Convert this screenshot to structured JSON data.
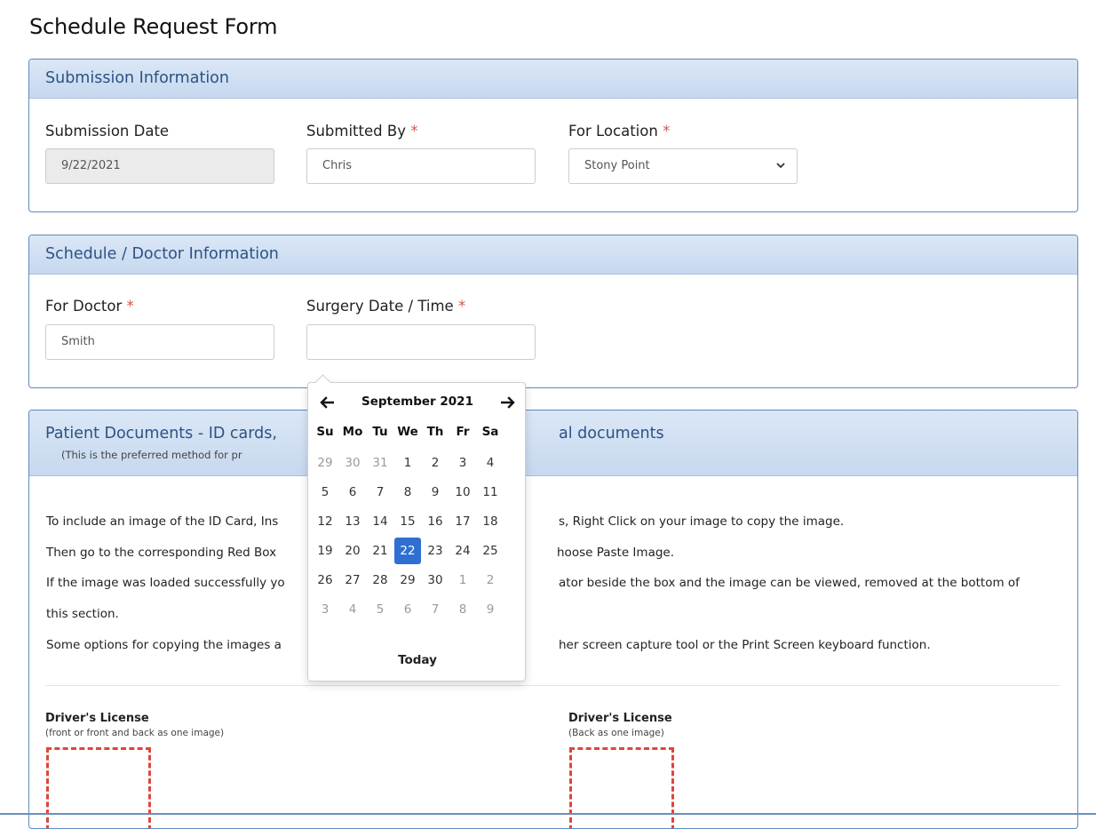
{
  "page": {
    "title": "Schedule Request Form"
  },
  "submission_panel": {
    "heading": "Submission Information",
    "submission_date": {
      "label": "Submission Date",
      "value": "9/22/2021"
    },
    "submitted_by": {
      "label": "Submitted By",
      "required_mark": "*",
      "value": "Chris"
    },
    "for_location": {
      "label": "For Location",
      "required_mark": "*",
      "value": "Stony Point"
    }
  },
  "schedule_panel": {
    "heading": "Schedule / Doctor Information",
    "for_doctor": {
      "label": "For Doctor",
      "required_mark": "*",
      "value": "Smith"
    },
    "surgery_date": {
      "label": "Surgery Date / Time",
      "required_mark": "*",
      "value": ""
    }
  },
  "documents_panel": {
    "heading_left": "Patient Documents - ID cards,",
    "heading_right": "al documents",
    "heading_sub": "(This is the preferred method for pr",
    "instructions": [
      {
        "left": "To include an image of the ID Card, Ins",
        "right": "s, Right Click on your image to copy the image."
      },
      {
        "left": "Then go to the corresponding Red Box",
        "right": "hoose Paste Image."
      },
      {
        "left": "If the image was loaded successfully yo",
        "right": "ator beside the box and the image can be viewed, removed at the bottom of"
      },
      {
        "left": "this section.",
        "right": ""
      },
      {
        "left": "Some options for copying the images a",
        "right": "her screen capture tool or the Print Screen keyboard function."
      }
    ],
    "uploads": [
      {
        "title": "Driver's License",
        "subtitle": "(front or front and back as one image)"
      },
      {
        "title": "Driver's License",
        "subtitle": "(Back as one image)"
      }
    ]
  },
  "datepicker": {
    "title": "September 2021",
    "prev_icon": "arrow-left-icon",
    "next_icon": "arrow-right-icon",
    "weekdays": [
      "Su",
      "Mo",
      "Tu",
      "We",
      "Th",
      "Fr",
      "Sa"
    ],
    "weeks": [
      [
        29,
        30,
        31,
        1,
        2,
        3,
        4
      ],
      [
        5,
        6,
        7,
        8,
        9,
        10,
        11
      ],
      [
        12,
        13,
        14,
        15,
        16,
        17,
        18
      ],
      [
        19,
        20,
        21,
        22,
        23,
        24,
        25
      ],
      [
        26,
        27,
        28,
        29,
        30,
        1,
        2
      ],
      [
        3,
        4,
        5,
        6,
        7,
        8,
        9
      ]
    ],
    "muted_cells": [
      [
        0,
        0
      ],
      [
        0,
        1
      ],
      [
        0,
        2
      ],
      [
        4,
        5
      ],
      [
        4,
        6
      ],
      [
        5,
        0
      ],
      [
        5,
        1
      ],
      [
        5,
        2
      ],
      [
        5,
        3
      ],
      [
        5,
        4
      ],
      [
        5,
        5
      ],
      [
        5,
        6
      ]
    ],
    "active_cell": [
      3,
      3
    ],
    "today_label": "Today",
    "accent_color": "#2f6fd1"
  },
  "colors": {
    "panel_border": "#5e89bf",
    "panel_heading_text": "#2c5283",
    "required_mark": "#d9534f",
    "drop_box_border": "#e0453b"
  }
}
